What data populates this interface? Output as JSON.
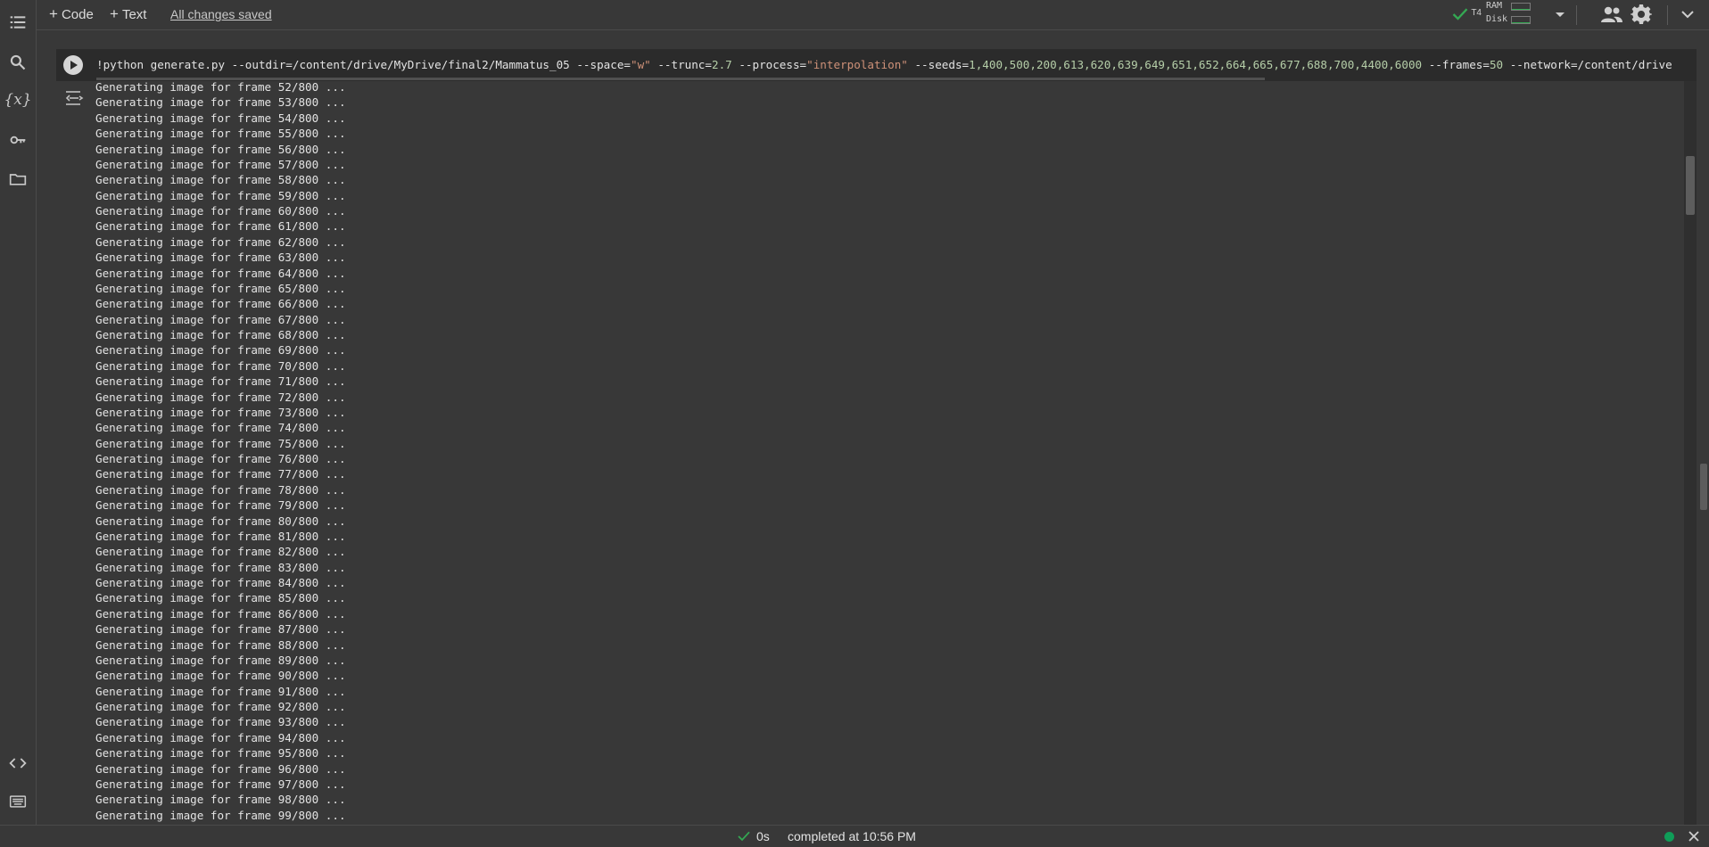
{
  "toolbar": {
    "code_label": "Code",
    "text_label": "Text",
    "saved_status": "All changes saved",
    "runtime_label": "T4",
    "ram_label": "RAM",
    "disk_label": "Disk",
    "ram_usage_fraction": 0.1,
    "disk_usage_fraction": 0.15
  },
  "sidebar": {
    "icons": [
      "table-of-contents-icon",
      "search-icon",
      "variables-icon",
      "secrets-key-icon",
      "files-folder-icon",
      "code-snippets-icon",
      "command-palette-icon"
    ],
    "variables_glyph": "{x}"
  },
  "cell": {
    "code_segments": [
      {
        "t": "!python generate.py --outdir=/content/drive/MyDrive/final2/Mammatus_05 --space=",
        "k": "plain"
      },
      {
        "t": "\"w\"",
        "k": "str"
      },
      {
        "t": " --trunc=",
        "k": "plain"
      },
      {
        "t": "2.7",
        "k": "num"
      },
      {
        "t": " --process=",
        "k": "plain"
      },
      {
        "t": "\"interpolation\"",
        "k": "str"
      },
      {
        "t": " --seeds=",
        "k": "plain"
      },
      {
        "t": "1,400,500,200,613,620,639,649,651,652,664,665,677,688,700,4400,6000",
        "k": "num"
      },
      {
        "t": " --frames=",
        "k": "plain"
      },
      {
        "t": "50",
        "k": "num"
      },
      {
        "t": " --network=/content/drive",
        "k": "plain"
      }
    ],
    "output_lines": [
      "Generating image for frame 52/800 ...",
      "Generating image for frame 53/800 ...",
      "Generating image for frame 54/800 ...",
      "Generating image for frame 55/800 ...",
      "Generating image for frame 56/800 ...",
      "Generating image for frame 57/800 ...",
      "Generating image for frame 58/800 ...",
      "Generating image for frame 59/800 ...",
      "Generating image for frame 60/800 ...",
      "Generating image for frame 61/800 ...",
      "Generating image for frame 62/800 ...",
      "Generating image for frame 63/800 ...",
      "Generating image for frame 64/800 ...",
      "Generating image for frame 65/800 ...",
      "Generating image for frame 66/800 ...",
      "Generating image for frame 67/800 ...",
      "Generating image for frame 68/800 ...",
      "Generating image for frame 69/800 ...",
      "Generating image for frame 70/800 ...",
      "Generating image for frame 71/800 ...",
      "Generating image for frame 72/800 ...",
      "Generating image for frame 73/800 ...",
      "Generating image for frame 74/800 ...",
      "Generating image for frame 75/800 ...",
      "Generating image for frame 76/800 ...",
      "Generating image for frame 77/800 ...",
      "Generating image for frame 78/800 ...",
      "Generating image for frame 79/800 ...",
      "Generating image for frame 80/800 ...",
      "Generating image for frame 81/800 ...",
      "Generating image for frame 82/800 ...",
      "Generating image for frame 83/800 ...",
      "Generating image for frame 84/800 ...",
      "Generating image for frame 85/800 ...",
      "Generating image for frame 86/800 ...",
      "Generating image for frame 87/800 ...",
      "Generating image for frame 88/800 ...",
      "Generating image for frame 89/800 ...",
      "Generating image for frame 90/800 ...",
      "Generating image for frame 91/800 ...",
      "Generating image for frame 92/800 ...",
      "Generating image for frame 93/800 ...",
      "Generating image for frame 94/800 ...",
      "Generating image for frame 95/800 ...",
      "Generating image for frame 96/800 ...",
      "Generating image for frame 97/800 ...",
      "Generating image for frame 98/800 ...",
      "Generating image for frame 99/800 ..."
    ]
  },
  "statusbar": {
    "duration": "0s",
    "completed_text": "completed at 10:56 PM"
  },
  "colors": {
    "accent_green": "#34a853",
    "status_dot": "#0f9d58",
    "string_literal": "#ce9178",
    "number_literal": "#b5cea8",
    "background": "#383838",
    "code_background": "#2b2b2b"
  }
}
